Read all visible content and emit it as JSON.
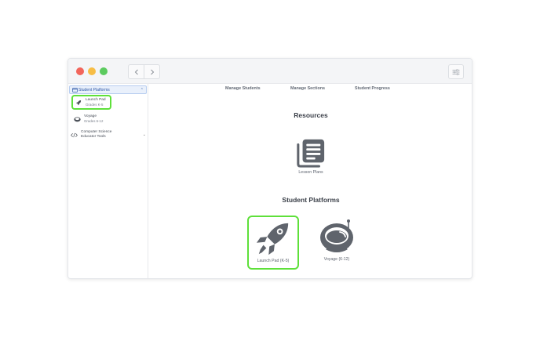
{
  "window": {
    "menu_icon": "sliders-menu-icon"
  },
  "nav": {
    "back_icon": "chevron-left-icon",
    "forward_icon": "chevron-right-icon"
  },
  "sidebar": {
    "header": {
      "label": "Student Platforms",
      "icon": "platform-icon",
      "expanded": true
    },
    "items": [
      {
        "line1": "Launch Pad",
        "line2": "Grades K-5",
        "icon": "rocket-icon",
        "highlighted": true
      },
      {
        "line1": "Voyage",
        "line2": "Grades 6-12",
        "icon": "helmet-icon"
      },
      {
        "line1": "Computer Science",
        "line2": "Educator Tools",
        "icon": "code-icon"
      }
    ]
  },
  "tabs": [
    "Manage Students",
    "Manage Sections",
    "Student Progress"
  ],
  "resources": {
    "title": "Resources",
    "items": [
      {
        "label": "Lesson Plans",
        "icon": "lesson-plans-icon"
      }
    ]
  },
  "platforms": {
    "title": "Student Platforms",
    "items": [
      {
        "label": "Launch Pad (K-5)",
        "icon": "rocket-icon",
        "highlighted": true
      },
      {
        "label": "Voyage (6-12)",
        "icon": "astronaut-helmet-icon"
      }
    ]
  },
  "colors": {
    "highlight": "#5ee03a",
    "icon_gray": "#5f646c",
    "sidebar_selected_bg": "#e9f0fb"
  }
}
